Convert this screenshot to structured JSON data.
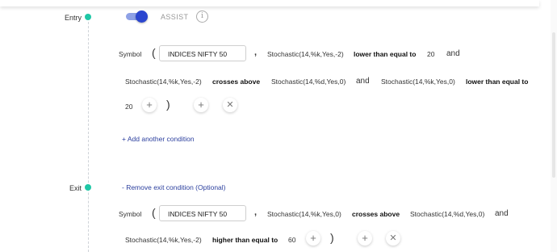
{
  "entry": {
    "label": "Entry",
    "assist_label": "ASSIST",
    "info_icon": "i",
    "row1": {
      "symbol_label": "Symbol",
      "open_paren": "(",
      "symbol_value": "INDICES NIFTY 50",
      "comma": ",",
      "indicator1": "Stochastic(14,%k,Yes,-2)",
      "operator1": "lower than equal to",
      "value1": "20",
      "joiner1": "and"
    },
    "row2": {
      "indicator1": "Stochastic(14,%k,Yes,-2)",
      "operator1": "crosses above",
      "indicator2": "Stochastic(14,%d,Yes,0)",
      "joiner": "and",
      "indicator3": "Stochastic(14,%k,Yes,0)",
      "operator2": "lower than equal to"
    },
    "row3": {
      "value": "20",
      "close_paren": ")"
    },
    "add_condition": "+ Add another condition"
  },
  "exit": {
    "label": "Exit",
    "remove_link": "- Remove exit condition (Optional)",
    "row1": {
      "symbol_label": "Symbol",
      "open_paren": "(",
      "symbol_value": "INDICES NIFTY 50",
      "comma": ",",
      "indicator1": "Stochastic(14,%k,Yes,0)",
      "operator1": "crosses above",
      "indicator2": "Stochastic(14,%d,Yes,0)",
      "joiner": "and"
    },
    "row2": {
      "indicator1": "Stochastic(14,%k,Yes,-2)",
      "operator1": "higher than equal to",
      "value1": "60",
      "close_paren": ")"
    }
  },
  "icons": {
    "plus": "+",
    "close": "✕"
  },
  "colors": {
    "accent": "#2b46cf",
    "timeline_dot": "#1fc7a6",
    "link": "#2b3f9e"
  }
}
